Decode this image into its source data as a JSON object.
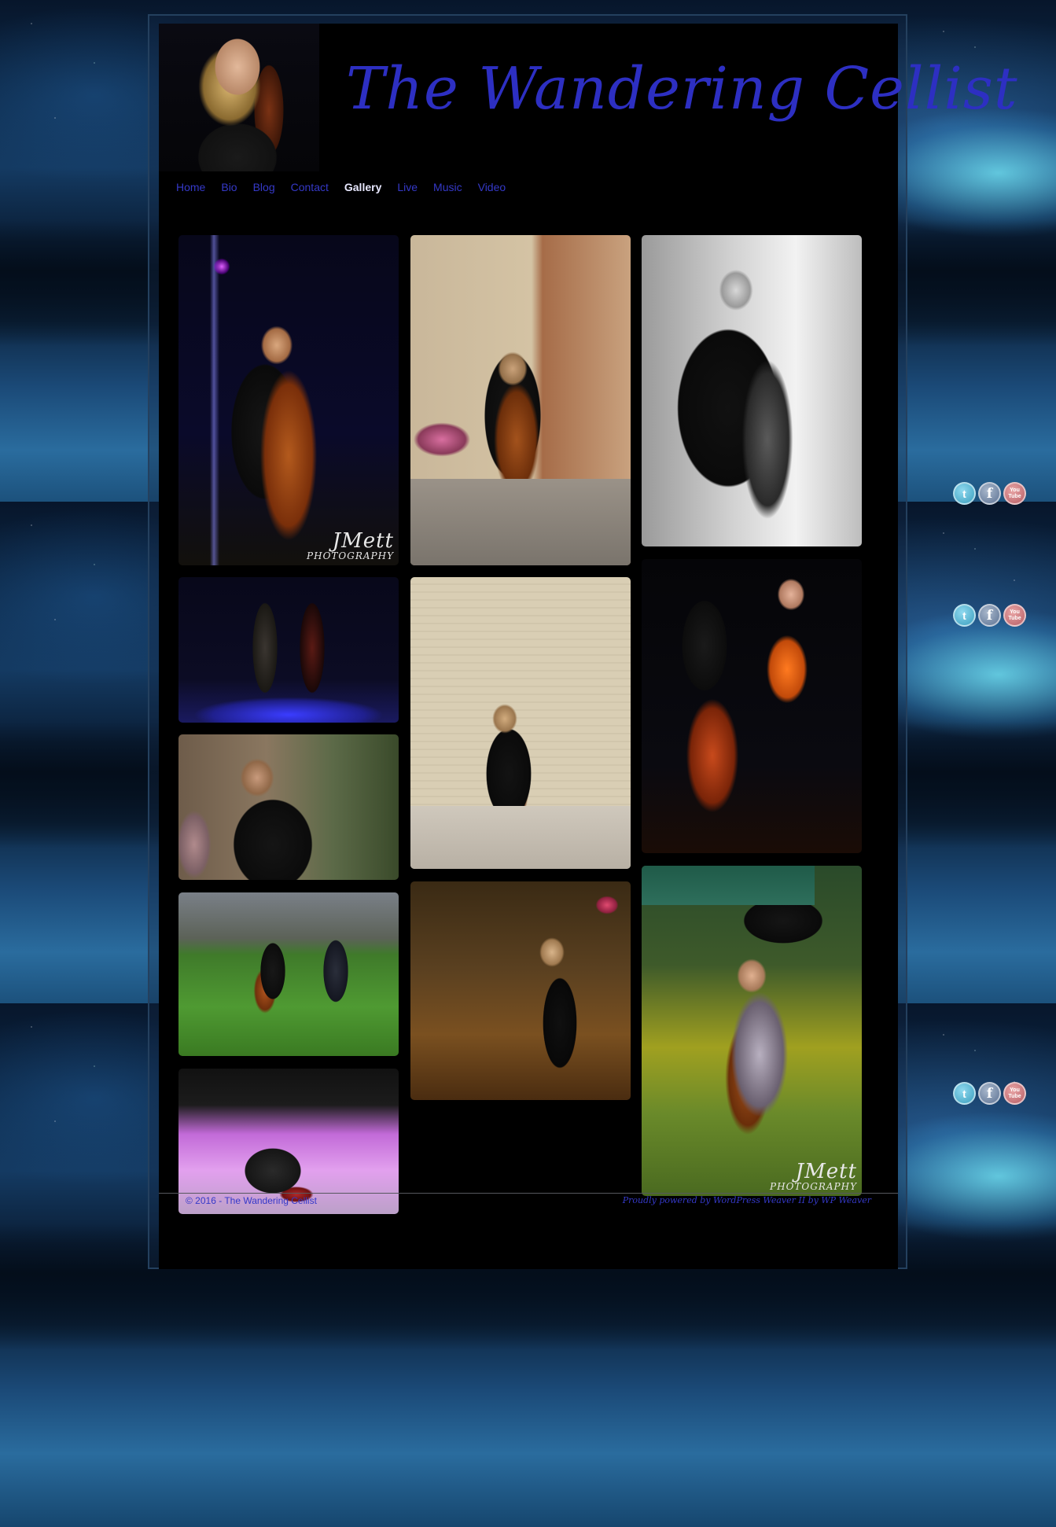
{
  "site": {
    "title": "The Wandering Cellist"
  },
  "nav": {
    "items": [
      {
        "label": "Home"
      },
      {
        "label": "Bio"
      },
      {
        "label": "Blog"
      },
      {
        "label": "Contact"
      },
      {
        "label": "Gallery"
      },
      {
        "label": "Live"
      },
      {
        "label": "Music"
      },
      {
        "label": "Video"
      }
    ],
    "active": "Gallery"
  },
  "gallery": {
    "watermark": {
      "line1": "JMett",
      "line2": "PHOTOGRAPHY"
    }
  },
  "social": {
    "twitter_icon": "twitter-icon",
    "facebook_icon": "facebook-icon",
    "youtube_icon": "youtube-icon",
    "youtube_text_top": "You",
    "youtube_text_bottom": "Tube"
  },
  "footer": {
    "copyright": "© 2016 - The Wandering Cellist",
    "powered_by": "Proudly powered by WordPress  Weaver II by WP Weaver"
  },
  "colors": {
    "link": "#3539c8",
    "title": "#2d2fc2",
    "active_nav": "#e8e8ff"
  }
}
